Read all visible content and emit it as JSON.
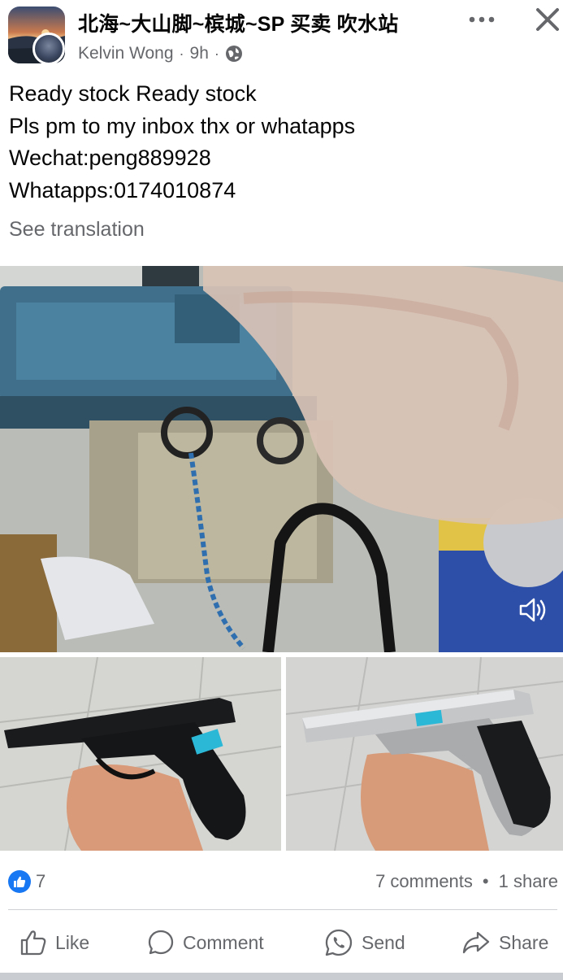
{
  "post": {
    "group_name": "北海~大山脚~槟城~SP 买卖 吹水站",
    "author": "Kelvin Wong",
    "time": "9h",
    "separator": "·",
    "audience_icon": "globe-icon",
    "text_lines": [
      "Ready stock Ready stock",
      "Pls pm to my inbox thx or whatapps",
      "Wechat:peng889928",
      "Whatapps:0174010874"
    ],
    "see_translation": "See translation"
  },
  "media": {
    "main_icon": "sound-icon",
    "images": [
      "video-frame",
      "black-pistol-photo",
      "silver-pistol-photo"
    ]
  },
  "stats": {
    "reaction_icon": "like-icon",
    "likes": "7",
    "comments": "7 comments",
    "dot": "•",
    "shares": "1 share"
  },
  "actions": {
    "like": "Like",
    "comment": "Comment",
    "send": "Send",
    "share": "Share"
  },
  "colors": {
    "accent": "#1877f2",
    "secondary_text": "#65676b",
    "divider": "#ced0d4"
  }
}
